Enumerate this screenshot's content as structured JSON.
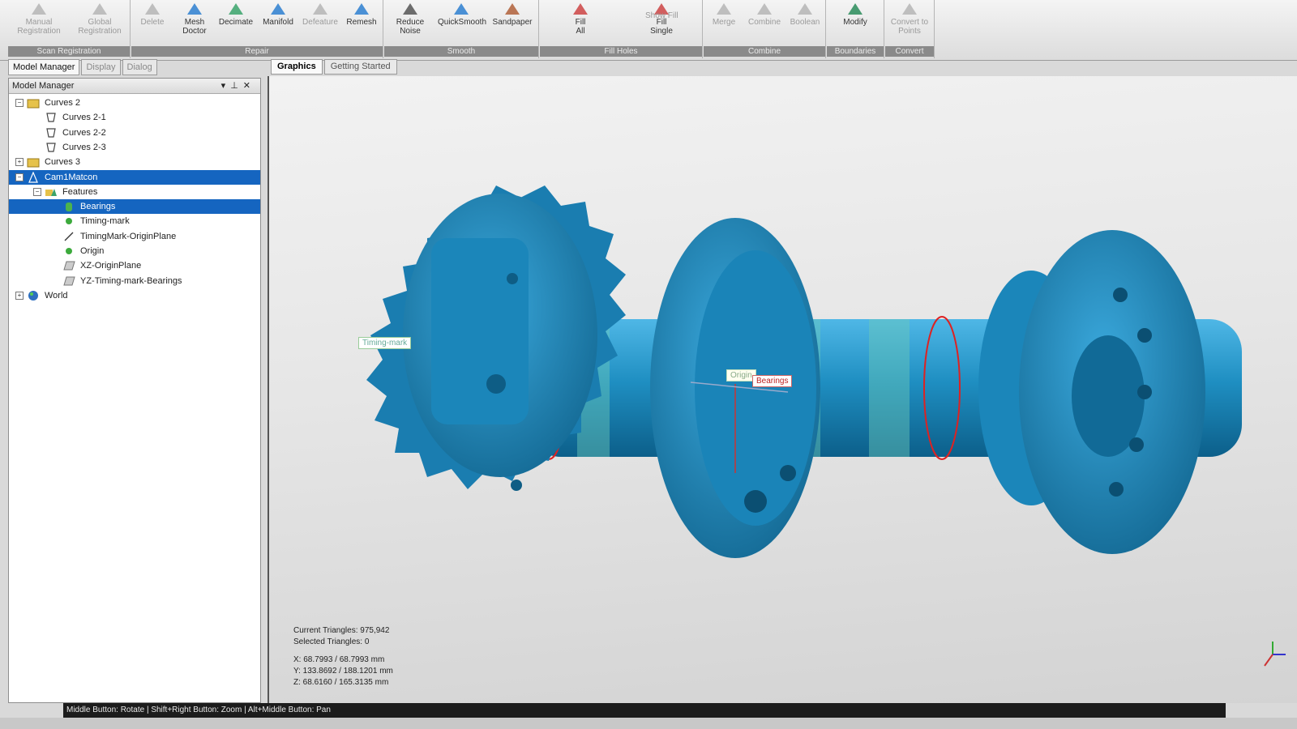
{
  "ribbon": {
    "groups": [
      {
        "label": "Scan Registration",
        "buttons": [
          {
            "label": "Manual\nRegistration",
            "icon": "manual-registration-icon",
            "enabled": false
          },
          {
            "label": "Global\nRegistration",
            "icon": "global-registration-icon",
            "enabled": false
          }
        ]
      },
      {
        "label": "Repair",
        "buttons": [
          {
            "label": "Delete",
            "icon": "delete-icon",
            "enabled": false
          },
          {
            "label": "Mesh\nDoctor",
            "icon": "mesh-doctor-icon",
            "enabled": true
          },
          {
            "label": "Decimate",
            "icon": "decimate-icon",
            "enabled": true
          },
          {
            "label": "Manifold",
            "icon": "manifold-icon",
            "enabled": true
          },
          {
            "label": "Defeature",
            "icon": "defeature-icon",
            "enabled": false
          },
          {
            "label": "Remesh",
            "icon": "remesh-icon",
            "enabled": true
          }
        ]
      },
      {
        "label": "Smooth",
        "buttons": [
          {
            "label": "Reduce\nNoise",
            "icon": "reduce-noise-icon",
            "enabled": true
          },
          {
            "label": "QuickSmooth",
            "icon": "quicksmooth-icon",
            "enabled": true
          },
          {
            "label": "Sandpaper",
            "icon": "sandpaper-icon",
            "enabled": true
          }
        ]
      },
      {
        "label": "Fill Holes",
        "buttons": [
          {
            "label": "Fill\nAll",
            "icon": "fill-all-icon",
            "enabled": true
          },
          {
            "label": "Fill\nSingle",
            "icon": "fill-single-icon",
            "enabled": true
          }
        ],
        "extra": "Show Fill"
      },
      {
        "label": "Combine",
        "buttons": [
          {
            "label": "Merge",
            "icon": "merge-icon",
            "enabled": false
          },
          {
            "label": "Combine",
            "icon": "combine-icon",
            "enabled": false
          },
          {
            "label": "Boolean",
            "icon": "boolean-icon",
            "enabled": false
          }
        ]
      },
      {
        "label": "Boundaries",
        "buttons": [
          {
            "label": "Modify",
            "icon": "modify-icon",
            "enabled": true
          }
        ]
      },
      {
        "label": "Convert",
        "buttons": [
          {
            "label": "Convert to\nPoints",
            "icon": "convert-to-points-icon",
            "enabled": false
          }
        ]
      }
    ]
  },
  "panel_tabs": [
    "Model Manager",
    "Display",
    "Dialog"
  ],
  "model_manager": {
    "title": "Model Manager",
    "tree": [
      {
        "label": "Curves 2",
        "level": 0,
        "icon": "curves-group-icon",
        "expander": "−"
      },
      {
        "label": "Curves 2-1",
        "level": 1,
        "icon": "curve-icon"
      },
      {
        "label": "Curves 2-2",
        "level": 1,
        "icon": "curve-icon"
      },
      {
        "label": "Curves 2-3",
        "level": 1,
        "icon": "curve-icon"
      },
      {
        "label": "Curves 3",
        "level": 0,
        "icon": "curves-group-icon",
        "expander": "+"
      },
      {
        "label": "Cam1Matcon",
        "level": 0,
        "icon": "mesh-icon",
        "expander": "−",
        "selected": true
      },
      {
        "label": "Features",
        "level": 1,
        "icon": "features-icon",
        "expander": "−"
      },
      {
        "label": "Bearings",
        "level": 2,
        "icon": "cylinder-icon",
        "selected": true
      },
      {
        "label": "Timing-mark",
        "level": 2,
        "icon": "point-icon"
      },
      {
        "label": "TimingMark-OriginPlane",
        "level": 2,
        "icon": "line-icon"
      },
      {
        "label": "Origin",
        "level": 2,
        "icon": "point-icon"
      },
      {
        "label": "XZ-OriginPlane",
        "level": 2,
        "icon": "plane-icon"
      },
      {
        "label": "YZ-Timing-mark-Bearings",
        "level": 2,
        "icon": "plane-icon"
      },
      {
        "label": "World",
        "level": 0,
        "icon": "world-icon",
        "expander": "+"
      }
    ]
  },
  "view_tabs": [
    "Graphics",
    "Getting Started"
  ],
  "viewport": {
    "annotations": {
      "timing": "Timing-mark",
      "origin": "Origin",
      "bearings": "Bearings"
    },
    "stats": {
      "current_triangles": "Current Triangles: 975,942",
      "selected_triangles": "Selected Triangles: 0"
    },
    "coords": {
      "x": "X:  68.7993 / 68.7993 mm",
      "y": "Y:  133.8692 / 188.1201 mm",
      "z": "Z:  68.6160 / 165.3135 mm"
    },
    "mesh_color": "#1f8fc2"
  },
  "statusbar": "Middle Button: Rotate | Shift+Right Button: Zoom | Alt+Middle Button: Pan"
}
